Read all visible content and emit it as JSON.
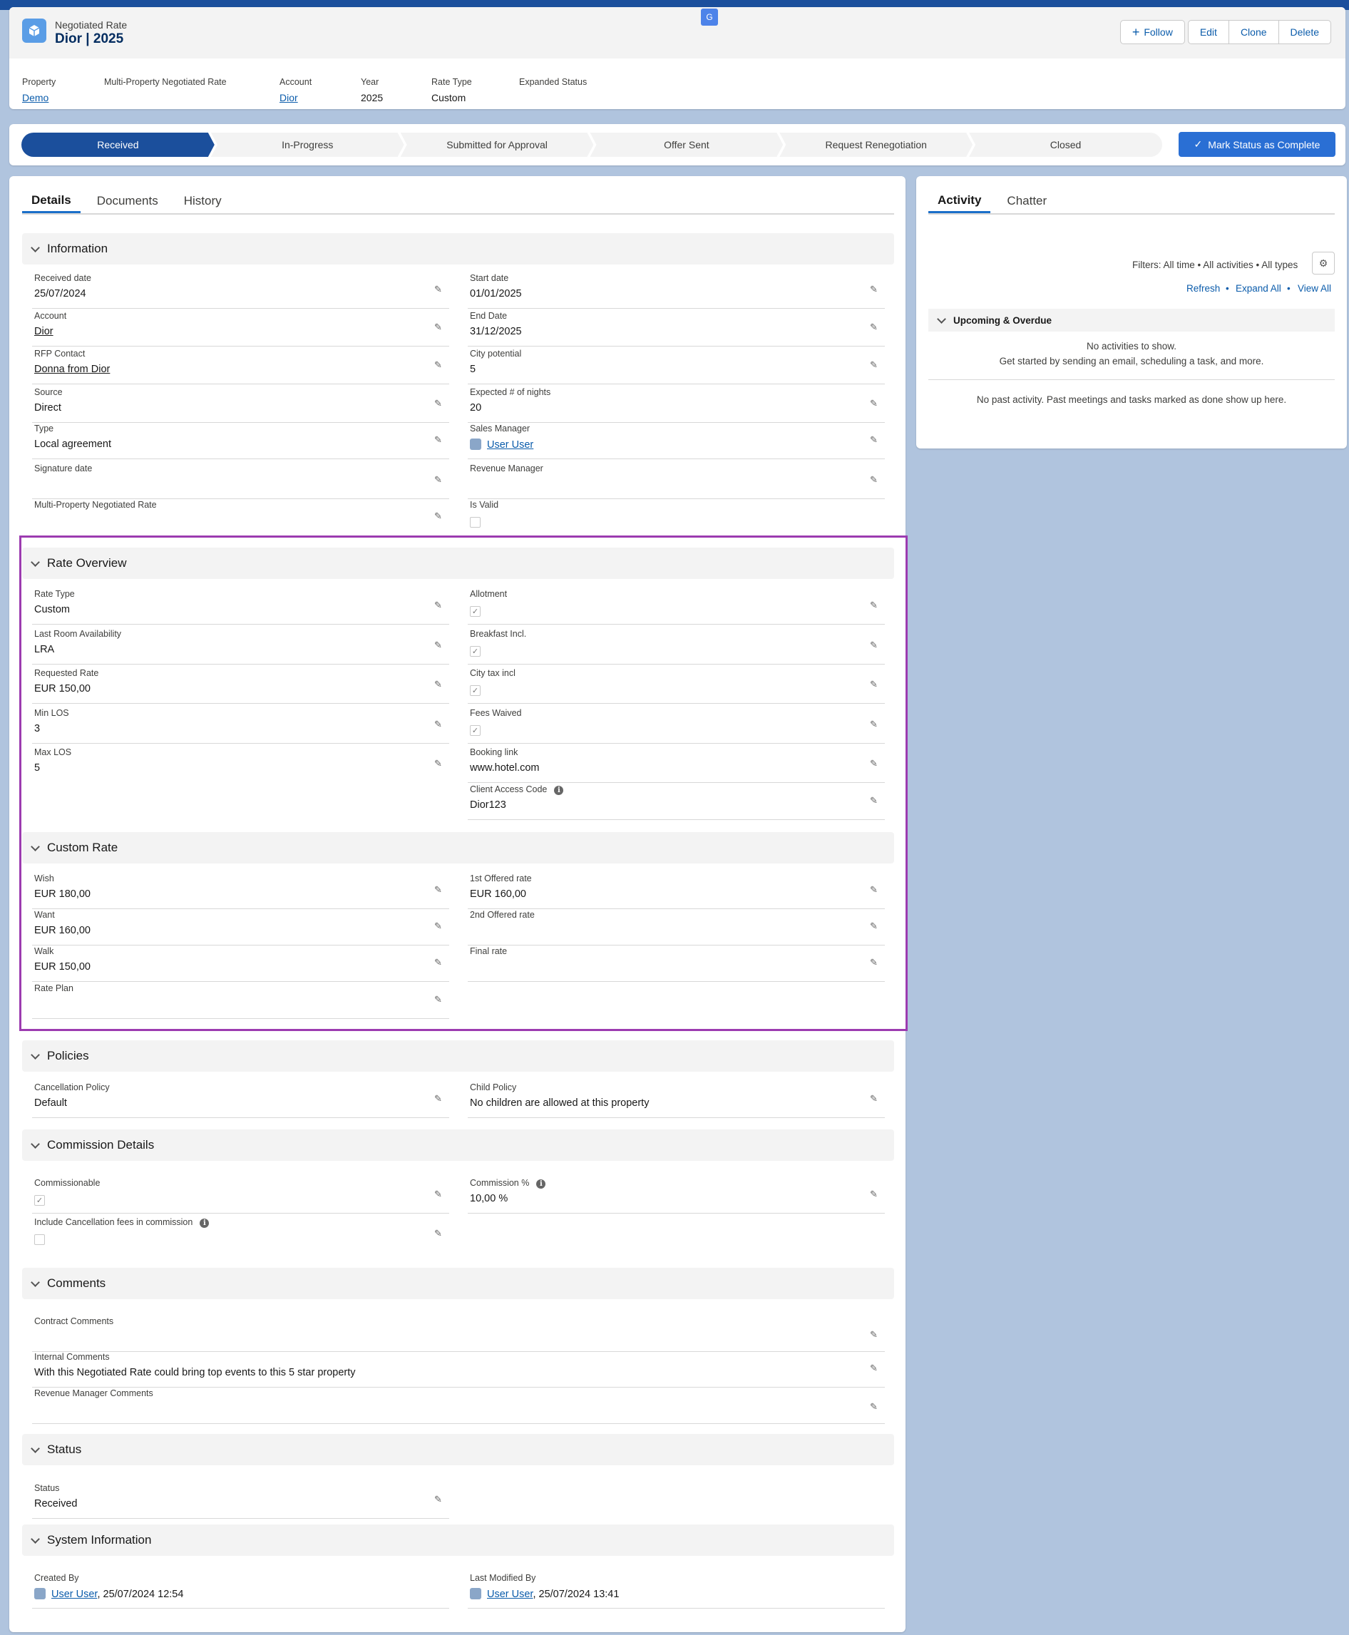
{
  "header": {
    "object_type": "Negotiated Rate",
    "title": "Dior | 2025",
    "buttons": {
      "follow": "Follow",
      "edit": "Edit",
      "clone": "Clone",
      "delete": "Delete"
    },
    "highlights": [
      {
        "label": "Property",
        "value": "Demo",
        "link": true
      },
      {
        "label": "Multi-Property Negotiated Rate",
        "value": ""
      },
      {
        "label": "Account",
        "value": "Dior",
        "link": true
      },
      {
        "label": "Year",
        "value": "2025"
      },
      {
        "label": "Rate Type",
        "value": "Custom"
      },
      {
        "label": "Expanded Status",
        "value": ""
      }
    ]
  },
  "path": {
    "stages": [
      "Received",
      "In-Progress",
      "Submitted for Approval",
      "Offer Sent",
      "Request Renegotiation",
      "Closed"
    ],
    "active": "Received",
    "mark_button": "Mark Status as Complete"
  },
  "tabs": [
    "Details",
    "Documents",
    "History"
  ],
  "sections": {
    "information": "Information",
    "rate_overview": "Rate Overview",
    "custom_rate": "Custom Rate",
    "policies": "Policies",
    "commission": "Commission Details",
    "comments": "Comments",
    "status": "Status",
    "system": "System Information"
  },
  "information": {
    "received_date": {
      "label": "Received date",
      "value": "25/07/2024"
    },
    "start_date": {
      "label": "Start date",
      "value": "01/01/2025"
    },
    "account": {
      "label": "Account",
      "value": "Dior"
    },
    "end_date": {
      "label": "End Date",
      "value": "31/12/2025"
    },
    "rfp_contact": {
      "label": "RFP Contact",
      "value": "Donna from Dior"
    },
    "city_potential": {
      "label": "City potential",
      "value": "5"
    },
    "source": {
      "label": "Source",
      "value": "Direct"
    },
    "expected_nights": {
      "label": "Expected # of nights",
      "value": "20"
    },
    "type": {
      "label": "Type",
      "value": "Local agreement"
    },
    "sales_manager": {
      "label": "Sales Manager",
      "value": "User User"
    },
    "signature_date": {
      "label": "Signature date",
      "value": ""
    },
    "revenue_manager": {
      "label": "Revenue Manager",
      "value": ""
    },
    "multi_property": {
      "label": "Multi-Property Negotiated Rate",
      "value": ""
    },
    "is_valid": {
      "label": "Is Valid",
      "checked": false
    }
  },
  "rate_overview": {
    "rate_type": {
      "label": "Rate Type",
      "value": "Custom"
    },
    "allotment": {
      "label": "Allotment",
      "checked": true
    },
    "lra": {
      "label": "Last Room Availability",
      "value": "LRA"
    },
    "breakfast": {
      "label": "Breakfast Incl.",
      "checked": true
    },
    "requested_rate": {
      "label": "Requested Rate",
      "value": "EUR 150,00"
    },
    "city_tax": {
      "label": "City tax incl",
      "checked": true
    },
    "min_los": {
      "label": "Min LOS",
      "value": "3"
    },
    "fees_waived": {
      "label": "Fees Waived",
      "checked": true
    },
    "max_los": {
      "label": "Max LOS",
      "value": "5"
    },
    "booking_link": {
      "label": "Booking link",
      "value": "www.hotel.com"
    },
    "client_code": {
      "label": "Client Access Code",
      "value": "Dior123"
    }
  },
  "custom_rate": {
    "wish": {
      "label": "Wish",
      "value": "EUR 180,00"
    },
    "offered1": {
      "label": "1st Offered rate",
      "value": "EUR 160,00"
    },
    "want": {
      "label": "Want",
      "value": "EUR 160,00"
    },
    "offered2": {
      "label": "2nd Offered rate",
      "value": ""
    },
    "walk": {
      "label": "Walk",
      "value": "EUR 150,00"
    },
    "final": {
      "label": "Final rate",
      "value": ""
    },
    "rate_plan": {
      "label": "Rate Plan",
      "value": ""
    }
  },
  "policies": {
    "cancellation": {
      "label": "Cancellation Policy",
      "value": "Default"
    },
    "child": {
      "label": "Child Policy",
      "value": "No children are allowed at this property"
    }
  },
  "commission": {
    "commissionable": {
      "label": "Commissionable",
      "checked": true
    },
    "percent": {
      "label": "Commission %",
      "value": "10,00 %"
    },
    "include_cancel": {
      "label": "Include Cancellation fees in commission",
      "checked": false
    }
  },
  "comments": {
    "contract": {
      "label": "Contract Comments",
      "value": ""
    },
    "internal": {
      "label": "Internal Comments",
      "value": "With this Negotiated Rate could bring top events to this 5 star property"
    },
    "revenue": {
      "label": "Revenue Manager Comments",
      "value": ""
    }
  },
  "status": {
    "label": "Status",
    "value": "Received"
  },
  "system": {
    "created_label": "Created By",
    "created_user": "User User",
    "created_date": ", 25/07/2024 12:54",
    "modified_label": "Last Modified By",
    "modified_user": "User User",
    "modified_date": ", 25/07/2024 13:41"
  },
  "activity": {
    "tabs": [
      "Activity",
      "Chatter"
    ],
    "filters": "Filters: All time • All activities • All types",
    "refresh": "Refresh",
    "expand_all": "Expand All",
    "view_all": "View All",
    "upcoming": "Upcoming & Overdue",
    "no_activities": "No activities to show.",
    "get_started": "Get started by sending an email, scheduling a task, and more.",
    "no_past": "No past activity. Past meetings and tasks marked as done show up here."
  },
  "colors": {
    "brand": "#1b4f9c",
    "highlight_box": "#9c3bb0",
    "link": "#0b5cab"
  }
}
